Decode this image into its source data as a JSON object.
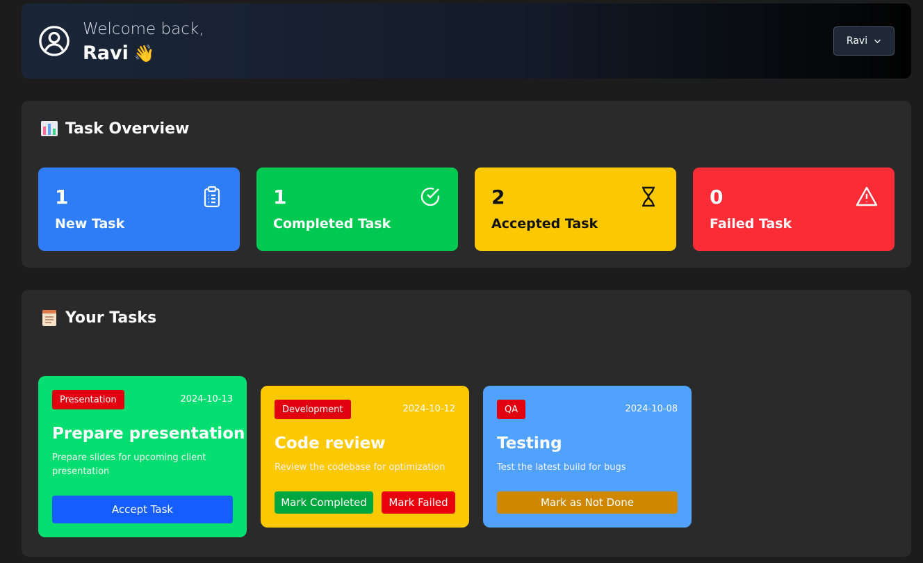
{
  "header": {
    "welcome": "Welcome back,",
    "name": "Ravi",
    "wave": "👋",
    "dropdown_label": "Ravi"
  },
  "overview": {
    "title": "Task Overview",
    "stats": [
      {
        "count": "1",
        "label": "New Task",
        "color": "#2f7df6",
        "icon": "clipboard-icon"
      },
      {
        "count": "1",
        "label": "Completed Task",
        "color": "#00c951",
        "icon": "check-circle-icon"
      },
      {
        "count": "2",
        "label": "Accepted Task",
        "color": "#fcc800",
        "icon": "hourglass-icon"
      },
      {
        "count": "0",
        "label": "Failed Task",
        "color": "#fb2c36",
        "icon": "warning-icon"
      }
    ]
  },
  "tasks": {
    "title": "Your Tasks",
    "items": [
      {
        "category": "Presentation",
        "date": "2024-10-13",
        "title": "Prepare presentation",
        "description": "Prepare slides for upcoming client presentation",
        "color": "#05df72",
        "actions": [
          {
            "label": "Accept Task",
            "color": "#155dfc"
          }
        ]
      },
      {
        "category": "Development",
        "date": "2024-10-12",
        "title": "Code review",
        "description": "Review the codebase for optimization",
        "color": "#fcc800",
        "actions": [
          {
            "label": "Mark Completed",
            "color": "#00a63e"
          },
          {
            "label": "Mark Failed",
            "color": "#e7000b"
          }
        ]
      },
      {
        "category": "QA",
        "date": "2024-10-08",
        "title": "Testing",
        "description": "Test the latest build for bugs",
        "color": "#51a2ff",
        "actions": [
          {
            "label": "Mark as Not Done",
            "color": "#d08700"
          }
        ]
      }
    ]
  }
}
